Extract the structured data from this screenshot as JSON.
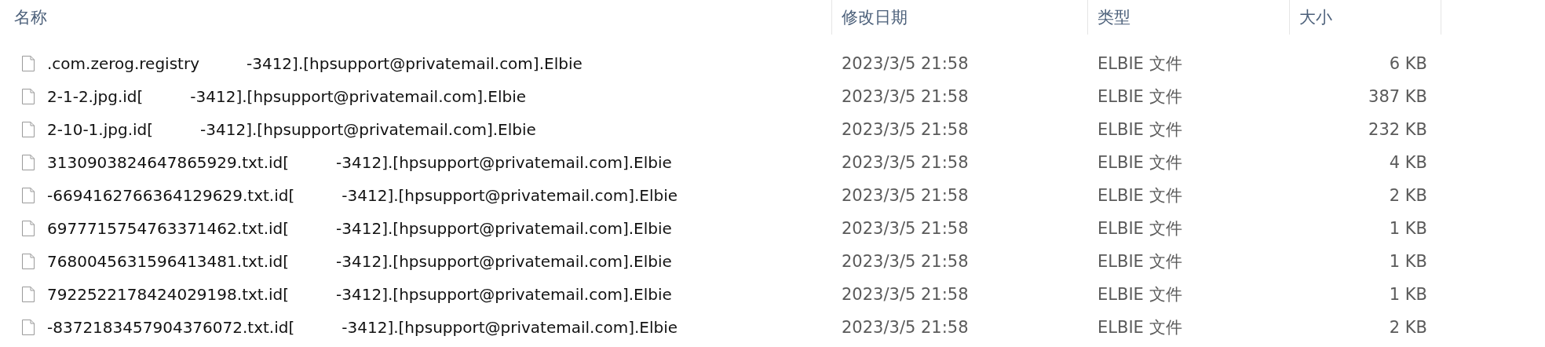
{
  "columns": [
    {
      "label": "名称"
    },
    {
      "label": "修改日期"
    },
    {
      "label": "类型"
    },
    {
      "label": "大小"
    }
  ],
  "rows": [
    {
      "name_prefix": ".com.zerog.registry",
      "name_suffix": "-3412].[hpsupport@privatemail.com].Elbie",
      "modified": "2023/3/5 21:58",
      "type": "ELBIE 文件",
      "size": "6 KB"
    },
    {
      "name_prefix": "2-1-2.jpg.id[",
      "name_suffix": "-3412].[hpsupport@privatemail.com].Elbie",
      "modified": "2023/3/5 21:58",
      "type": "ELBIE 文件",
      "size": "387 KB"
    },
    {
      "name_prefix": "2-10-1.jpg.id[",
      "name_suffix": "-3412].[hpsupport@privatemail.com].Elbie",
      "modified": "2023/3/5 21:58",
      "type": "ELBIE 文件",
      "size": "232 KB"
    },
    {
      "name_prefix": "3130903824647865929.txt.id[",
      "name_suffix": "-3412].[hpsupport@privatemail.com].Elbie",
      "modified": "2023/3/5 21:58",
      "type": "ELBIE 文件",
      "size": "4 KB"
    },
    {
      "name_prefix": "-6694162766364129629.txt.id[",
      "name_suffix": "-3412].[hpsupport@privatemail.com].Elbie",
      "modified": "2023/3/5 21:58",
      "type": "ELBIE 文件",
      "size": "2 KB"
    },
    {
      "name_prefix": "6977715754763371462.txt.id[",
      "name_suffix": "-3412].[hpsupport@privatemail.com].Elbie",
      "modified": "2023/3/5 21:58",
      "type": "ELBIE 文件",
      "size": "1 KB"
    },
    {
      "name_prefix": "7680045631596413481.txt.id[",
      "name_suffix": "-3412].[hpsupport@privatemail.com].Elbie",
      "modified": "2023/3/5 21:58",
      "type": "ELBIE 文件",
      "size": "1 KB"
    },
    {
      "name_prefix": "7922522178424029198.txt.id[",
      "name_suffix": "-3412].[hpsupport@privatemail.com].Elbie",
      "modified": "2023/3/5 21:58",
      "type": "ELBIE 文件",
      "size": "1 KB"
    },
    {
      "name_prefix": "-8372183457904376072.txt.id[",
      "name_suffix": "-3412].[hpsupport@privatemail.com].Elbie",
      "modified": "2023/3/5 21:58",
      "type": "ELBIE 文件",
      "size": "2 KB"
    }
  ]
}
